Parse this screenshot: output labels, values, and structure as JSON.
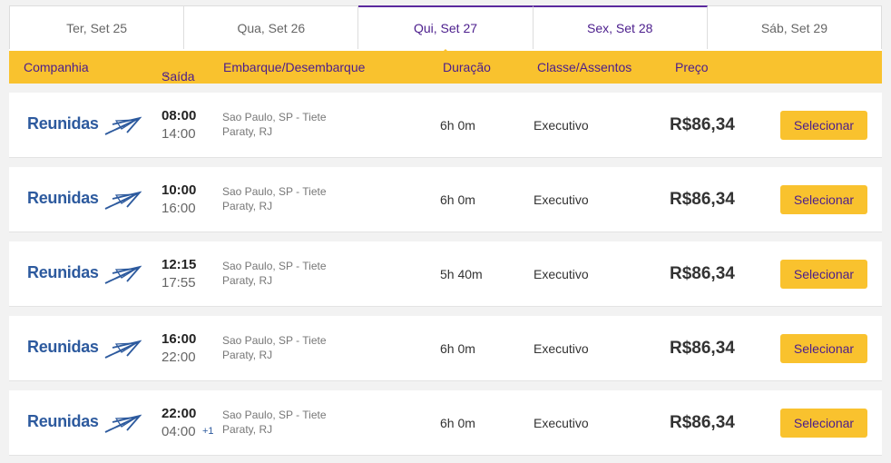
{
  "date_tabs": [
    {
      "label": "Ter, Set 25"
    },
    {
      "label": "Qua, Set 26"
    },
    {
      "label": "Qui, Set 27"
    },
    {
      "label": "Sex, Set 28"
    },
    {
      "label": "Sáb, Set 29"
    }
  ],
  "active_tab": "Qui, Set 27",
  "headers": {
    "company": "Companhia",
    "departure": "Saída",
    "route": "Embarque/Desembarque",
    "duration": "Duração",
    "class": "Classe/Assentos",
    "price": "Preço"
  },
  "colors": {
    "accent": "#f9c22e",
    "brand_purple": "#4b1d8c",
    "logo_blue": "#2d5a9e"
  },
  "trips": [
    {
      "company": "Reunidas",
      "departure": "08:00",
      "arrival": "14:00",
      "next_day": "",
      "origin": "Sao Paulo, SP - Tiete",
      "destination": "Paraty, RJ",
      "duration": "6h 0m",
      "class": "Executivo",
      "price": "R$86,34",
      "button": "Selecionar"
    },
    {
      "company": "Reunidas",
      "departure": "10:00",
      "arrival": "16:00",
      "next_day": "",
      "origin": "Sao Paulo, SP - Tiete",
      "destination": "Paraty, RJ",
      "duration": "6h 0m",
      "class": "Executivo",
      "price": "R$86,34",
      "button": "Selecionar"
    },
    {
      "company": "Reunidas",
      "departure": "12:15",
      "arrival": "17:55",
      "next_day": "",
      "origin": "Sao Paulo, SP - Tiete",
      "destination": "Paraty, RJ",
      "duration": "5h 40m",
      "class": "Executivo",
      "price": "R$86,34",
      "button": "Selecionar"
    },
    {
      "company": "Reunidas",
      "departure": "16:00",
      "arrival": "22:00",
      "next_day": "",
      "origin": "Sao Paulo, SP - Tiete",
      "destination": "Paraty, RJ",
      "duration": "6h 0m",
      "class": "Executivo",
      "price": "R$86,34",
      "button": "Selecionar"
    },
    {
      "company": "Reunidas",
      "departure": "22:00",
      "arrival": "04:00",
      "next_day": "+1",
      "origin": "Sao Paulo, SP - Tiete",
      "destination": "Paraty, RJ",
      "duration": "6h 0m",
      "class": "Executivo",
      "price": "R$86,34",
      "button": "Selecionar"
    }
  ]
}
